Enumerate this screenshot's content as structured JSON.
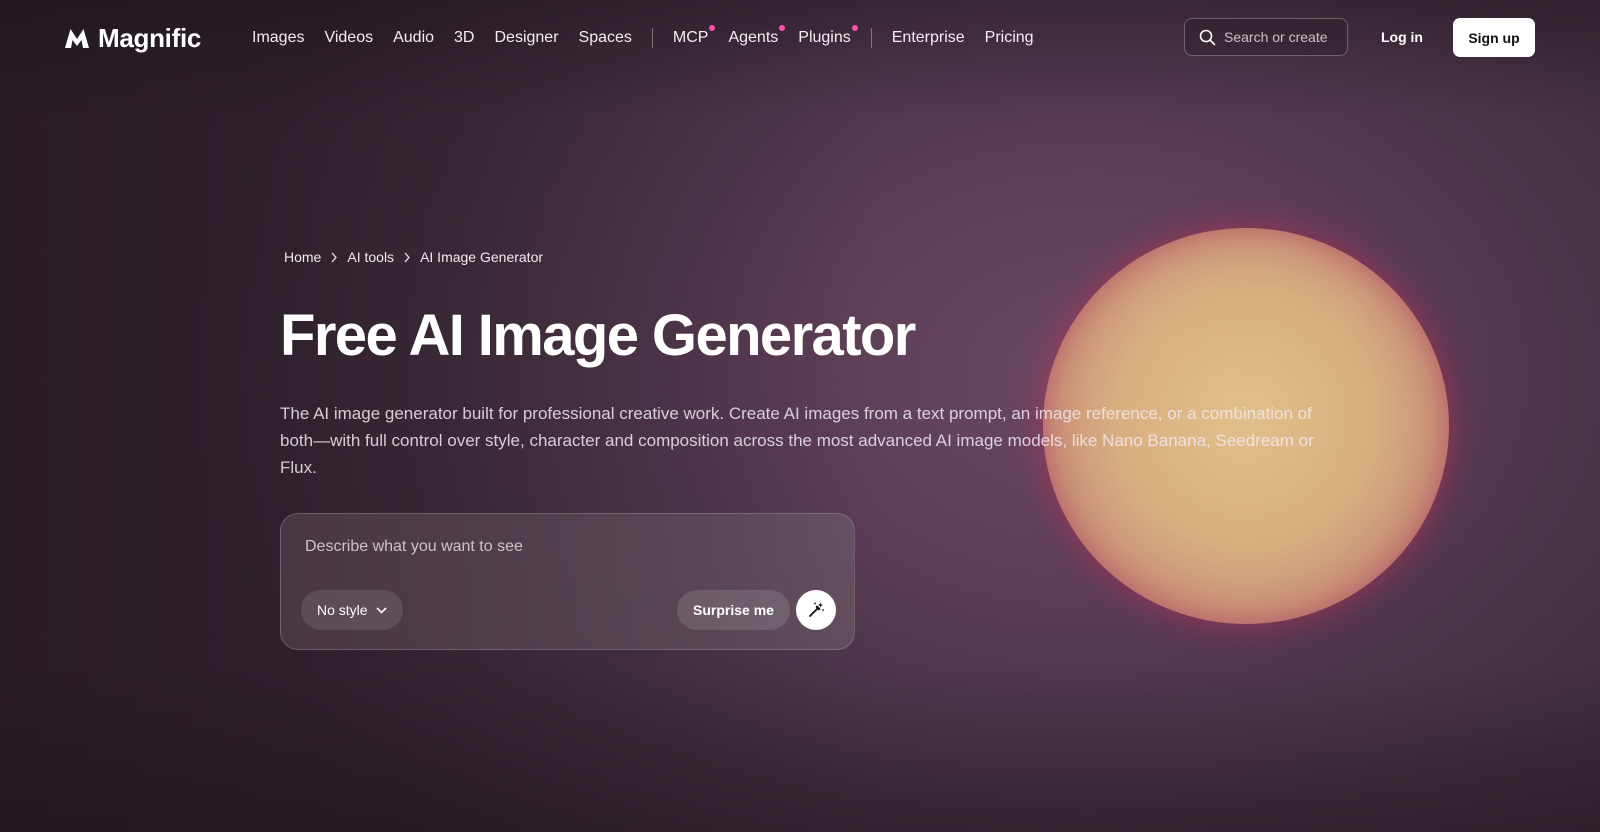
{
  "brand": {
    "name": "Magnific"
  },
  "nav": {
    "links": [
      {
        "label": "Images",
        "dot": false
      },
      {
        "label": "Videos",
        "dot": false
      },
      {
        "label": "Audio",
        "dot": false
      },
      {
        "label": "3D",
        "dot": false
      },
      {
        "label": "Designer",
        "dot": false
      },
      {
        "label": "Spaces",
        "dot": false
      },
      {
        "label": "MCP",
        "dot": true
      },
      {
        "label": "Agents",
        "dot": true
      },
      {
        "label": "Plugins",
        "dot": true
      },
      {
        "label": "Enterprise",
        "dot": false
      },
      {
        "label": "Pricing",
        "dot": false
      }
    ],
    "search_label": "Search or create",
    "login_label": "Log in",
    "signup_label": "Sign up"
  },
  "breadcrumb": [
    "Home",
    "AI tools",
    "AI Image Generator"
  ],
  "hero": {
    "title": "Free AI Image Generator",
    "description": "The AI image generator built for professional creative work. Create AI images from a text prompt, an image reference, or a combination of both—with full control over style, character and composition across the most advanced AI image models, like Nano Banana, Seedream or Flux."
  },
  "prompt": {
    "placeholder": "Describe what you want to see",
    "style_label": "No style",
    "surprise_label": "Surprise me"
  },
  "colors": {
    "accent_dot": "#ff4fa8",
    "background": "#4a3446",
    "signup_bg": "#ffffff"
  }
}
